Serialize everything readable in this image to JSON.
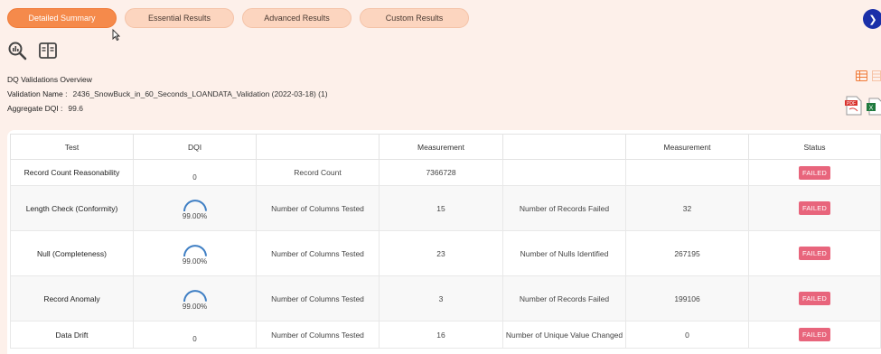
{
  "tabs": [
    {
      "label": "Detailed Summary",
      "active": true
    },
    {
      "label": "Essential Results",
      "active": false
    },
    {
      "label": "Advanced Results",
      "active": false
    },
    {
      "label": "Custom Results",
      "active": false
    }
  ],
  "overview": {
    "title": "DQ Validations Overview",
    "validation_name_label": "Validation Name :",
    "validation_name": "2436_SnowBuck_in_60_Seconds_LOANDATA_Validation (2022-03-18) (1)",
    "aggregate_label": "Aggregate DQI :",
    "aggregate_value": "99.6"
  },
  "table": {
    "headers": [
      "Test",
      "DQI",
      "",
      "Measurement",
      "",
      "Measurement",
      "Status"
    ],
    "rows": [
      {
        "test": "Record Count Reasonability",
        "dqi": "0",
        "dqi_gauge": false,
        "m1_label": "Record Count",
        "m1_value": "7366728",
        "m2_label": "",
        "m2_value": "",
        "status": "FAILED"
      },
      {
        "test": "Length Check (Conformity)",
        "dqi": "99.00%",
        "dqi_gauge": true,
        "dqi_fraction": 0.99,
        "m1_label": "Number of Columns Tested",
        "m1_value": "15",
        "m2_label": "Number of Records Failed",
        "m2_value": "32",
        "status": "FAILED"
      },
      {
        "test": "Null (Completeness)",
        "dqi": "99.00%",
        "dqi_gauge": true,
        "dqi_fraction": 0.99,
        "m1_label": "Number of Columns Tested",
        "m1_value": "23",
        "m2_label": "Number of Nulls Identified",
        "m2_value": "267195",
        "status": "FAILED"
      },
      {
        "test": "Record Anomaly",
        "dqi": "99.00%",
        "dqi_gauge": true,
        "dqi_fraction": 0.99,
        "m1_label": "Number of Columns Tested",
        "m1_value": "3",
        "m2_label": "Number of Records Failed",
        "m2_value": "199106",
        "status": "FAILED"
      },
      {
        "test": "Data Drift",
        "dqi": "0",
        "dqi_gauge": false,
        "m1_label": "Number of Columns Tested",
        "m1_value": "16",
        "m2_label": "Number of Unique Value Changed",
        "m2_value": "0",
        "status": "FAILED"
      }
    ]
  },
  "colors": {
    "accent": "#f58a4b",
    "tab_bg": "#fcd5bf",
    "page_bg": "#fdf0ea",
    "failed": "#e8657c",
    "gauge": "#3f7fc4",
    "next_button": "#1a2fa8"
  },
  "icons": {
    "tool1": "search-analytics-icon",
    "tool2": "book-compare-icon",
    "next": "chevron-right-icon",
    "grid_view": "grid-view-icon",
    "list_view": "list-view-icon",
    "pdf": "pdf-export-icon",
    "excel": "excel-export-icon"
  }
}
